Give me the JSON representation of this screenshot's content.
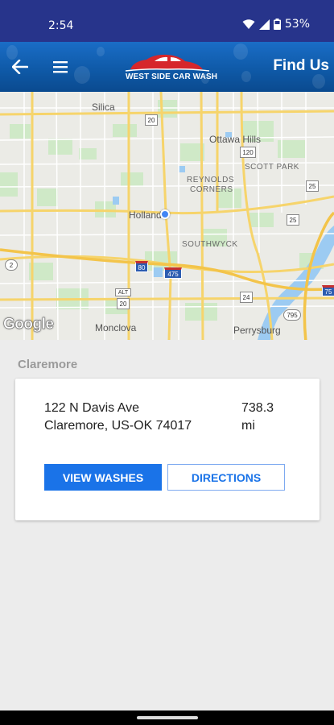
{
  "status_bar": {
    "time": "2:54",
    "battery": "53%",
    "icons": [
      "wifi-icon",
      "signal-icon",
      "battery-icon"
    ]
  },
  "app_bar": {
    "title": "Find Us",
    "logo_text_1": "WEST SIDE ",
    "logo_text_2": "CAR WASH",
    "back_icon": "arrow-left-icon",
    "menu_icon": "hamburger-menu-icon",
    "colors": {
      "bar": "#0f5aa8",
      "logo_red": "#d6262b"
    }
  },
  "map": {
    "labels": {
      "silica": "Silica",
      "ottawa_hills": "Ottawa Hills",
      "scott_park": "SCOTT PARK",
      "reynolds": "REYNOLDS",
      "corners": "CORNERS",
      "holland": "Holland",
      "southwyck": "SOUTHWYCK",
      "monclova": "Monclova",
      "perrysburg": "Perrysburg"
    },
    "shields": {
      "s20": "20",
      "s120": "120",
      "s25a": "25",
      "s25b": "25",
      "s2": "2",
      "s80": "80",
      "s475": "475",
      "s24": "24",
      "salt": "ALT",
      "s20b": "20",
      "s795": "795",
      "s75": "75"
    },
    "attribution": "Google"
  },
  "location": {
    "section_title": "Claremore",
    "address_line1": "122 N Davis Ave",
    "address_line2": "Claremore, US-OK  74017",
    "distance_value": "738.3",
    "distance_unit": "mi",
    "view_washes_label": "VIEW WASHES",
    "directions_label": "DIRECTIONS"
  }
}
